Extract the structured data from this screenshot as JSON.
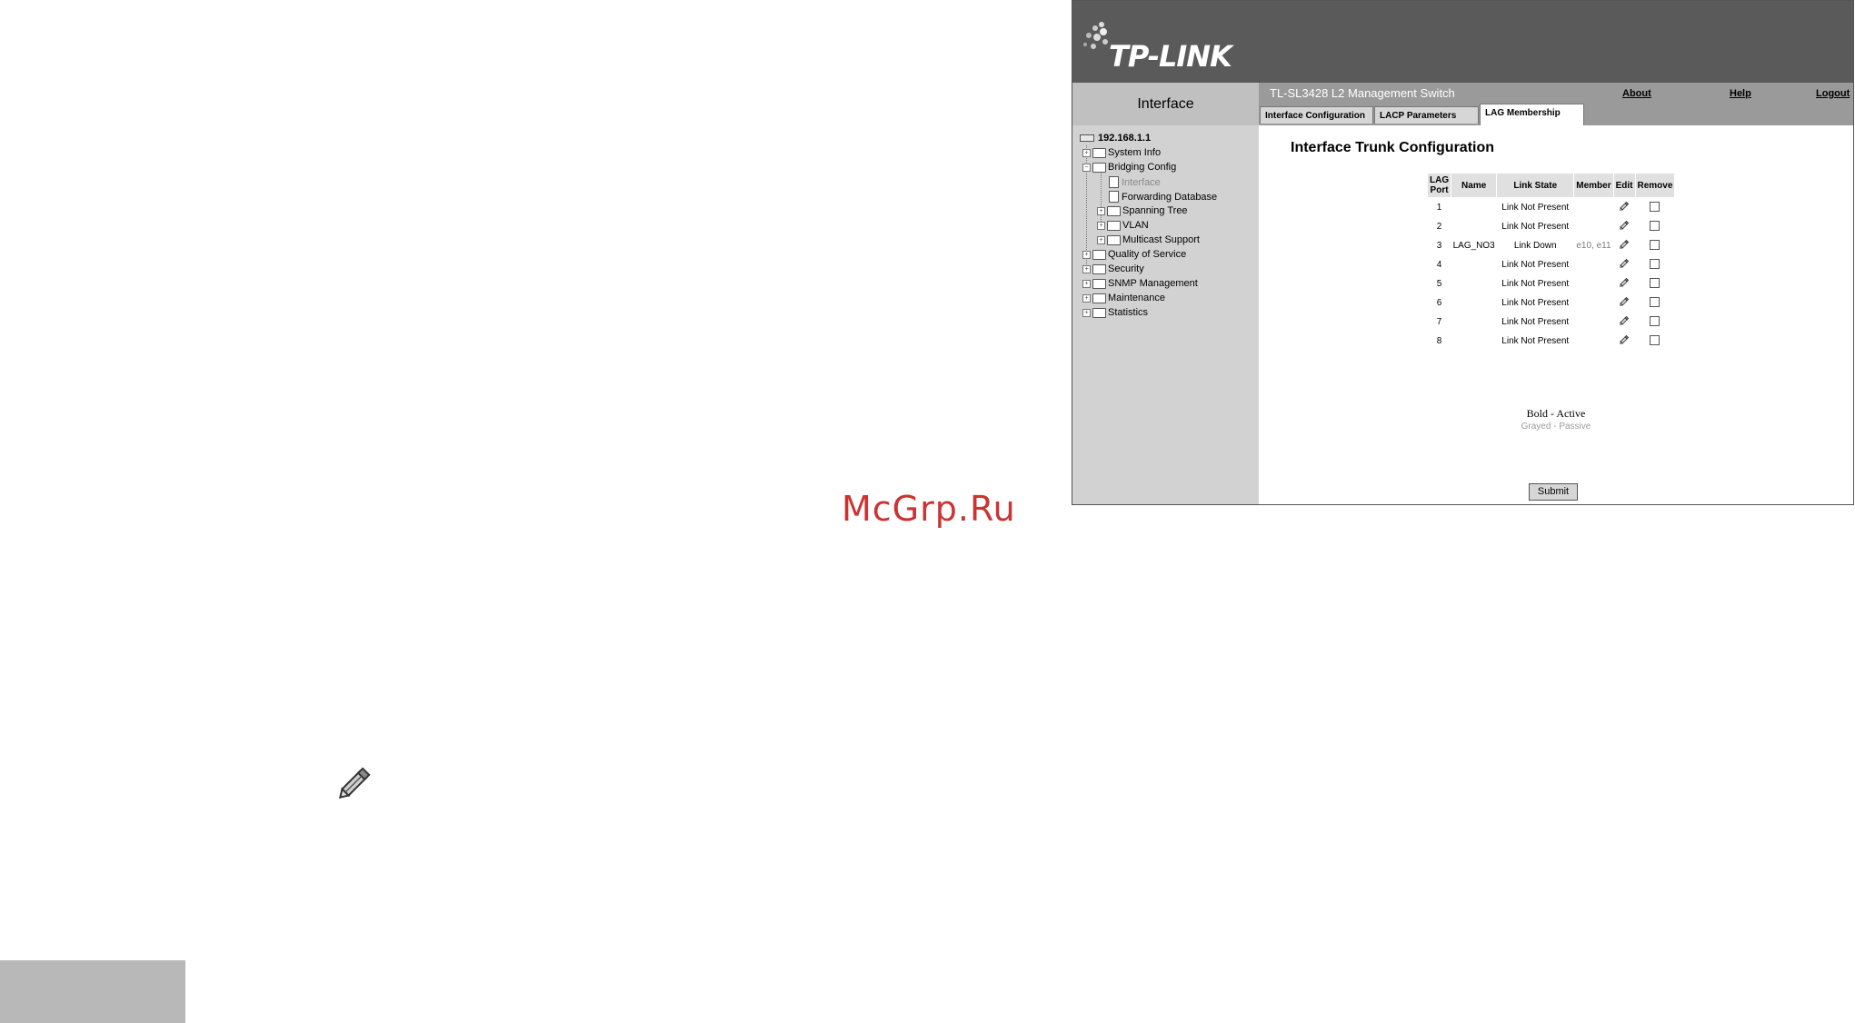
{
  "watermark": "McGrp.Ru",
  "brand": {
    "logo_text": "TP-LINK",
    "banner_color": "#5a5a5a"
  },
  "sidebar": {
    "header": "Interface",
    "host": "192.168.1.1",
    "items": [
      {
        "label": "System Info"
      },
      {
        "label": "Bridging Config"
      },
      {
        "label": "Interface"
      },
      {
        "label": "Forwarding Database"
      },
      {
        "label": "Spanning Tree"
      },
      {
        "label": "VLAN"
      },
      {
        "label": "Multicast Support"
      },
      {
        "label": "Quality of Service"
      },
      {
        "label": "Security"
      },
      {
        "label": "SNMP Management"
      },
      {
        "label": "Maintenance"
      },
      {
        "label": "Statistics"
      }
    ]
  },
  "header": {
    "product": "TL-SL3428 L2 Management Switch",
    "links": {
      "about": "About",
      "help": "Help",
      "logout": "Logout"
    },
    "tabs": [
      {
        "label": "Interface Configuration"
      },
      {
        "label": "LACP Parameters"
      },
      {
        "label": "LAG Membership"
      }
    ],
    "active_tab": "LAG Membership"
  },
  "main": {
    "title": "Interface Trunk Configuration",
    "table": {
      "headers": {
        "lag_port_1": "LAG",
        "lag_port_2": "Port",
        "name": "Name",
        "link_state": "Link State",
        "member": "Member",
        "edit": "Edit",
        "remove": "Remove"
      },
      "rows": [
        {
          "lag": "1",
          "name": "",
          "link_state": "Link Not Present",
          "member": ""
        },
        {
          "lag": "2",
          "name": "",
          "link_state": "Link Not Present",
          "member": ""
        },
        {
          "lag": "3",
          "name": "LAG_NO3",
          "link_state": "Link Down",
          "member": "e10, e11"
        },
        {
          "lag": "4",
          "name": "",
          "link_state": "Link Not Present",
          "member": ""
        },
        {
          "lag": "5",
          "name": "",
          "link_state": "Link Not Present",
          "member": ""
        },
        {
          "lag": "6",
          "name": "",
          "link_state": "Link Not Present",
          "member": ""
        },
        {
          "lag": "7",
          "name": "",
          "link_state": "Link Not Present",
          "member": ""
        },
        {
          "lag": "8",
          "name": "",
          "link_state": "Link Not Present",
          "member": ""
        }
      ]
    },
    "legend": {
      "active": "Bold - Active",
      "passive": "Grayed - Passive"
    },
    "submit_label": "Submit"
  }
}
